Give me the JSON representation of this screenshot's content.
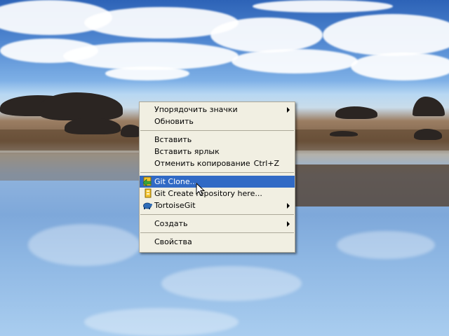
{
  "desktop": {
    "context_menu": {
      "items": [
        {
          "label": "Упорядочить значки",
          "has_submenu": true
        },
        {
          "label": "Обновить"
        },
        {
          "label": "Вставить"
        },
        {
          "label": "Вставить ярлык"
        },
        {
          "label": "Отменить копирование",
          "shortcut": "Ctrl+Z"
        },
        {
          "label": "Git Clone...",
          "icon": "git-clone-icon",
          "highlighted": true
        },
        {
          "label": "Git Create repository here...",
          "icon": "git-create-repository-icon"
        },
        {
          "label": "TortoiseGit",
          "icon": "tortoisegit-icon",
          "has_submenu": true
        },
        {
          "label": "Создать",
          "has_submenu": true
        },
        {
          "label": "Свойства"
        }
      ],
      "highlight_color": "#316ac5",
      "background_color": "#f1efe2"
    },
    "cursor": "arrow-cursor-icon"
  }
}
